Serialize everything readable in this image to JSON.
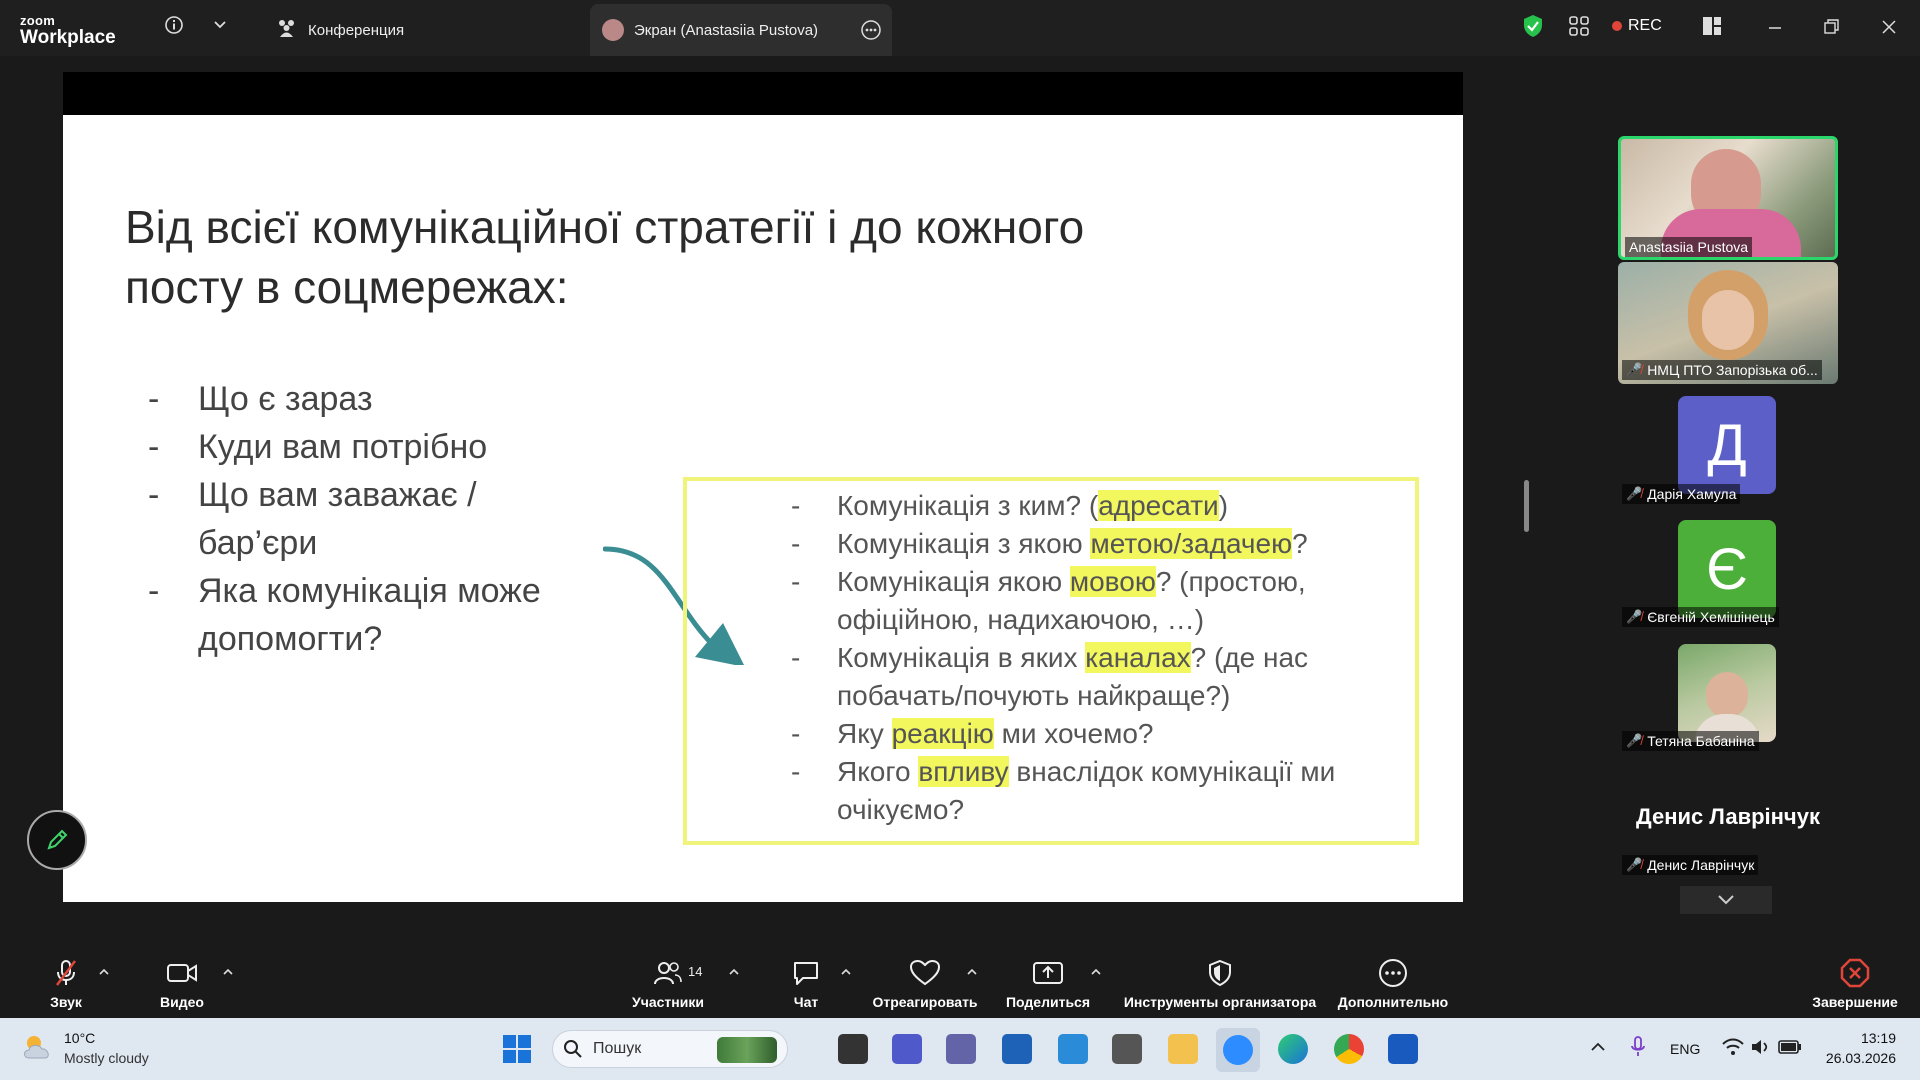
{
  "titlebar": {
    "logo_small": "zoom",
    "logo_big": "Workplace",
    "tabs": [
      {
        "label": "Конференция"
      },
      {
        "label": "Экран (Anastasiia Pustova)"
      }
    ],
    "rec_label": "REC"
  },
  "slide": {
    "title_line1": "Від всієї комунікаційної стратегії і до кожного",
    "title_line2": "посту в соцмережах:",
    "left_items": [
      "Що є зараз",
      "Куди вам потрібно",
      "Що вам заважає / бар’єри",
      "Яка комунікація може допомогти?"
    ],
    "right_items": [
      {
        "pre": "Комунікація з ким? (",
        "hl": "адресати",
        "post": ")"
      },
      {
        "pre": "Комунікація з якою ",
        "hl": "метою/задачею",
        "post": "?"
      },
      {
        "pre": "Комунікація якою ",
        "hl": "мовою",
        "post": "? (простою, офіційною, надихаючою, …)"
      },
      {
        "pre": "Комунікація в яких ",
        "hl": "каналах",
        "post": "? (де нас побачать/почують найкраще?)"
      },
      {
        "pre": "Яку ",
        "hl": "реакцію",
        "post": " ми хочемо?"
      },
      {
        "pre": "Якого ",
        "hl": "впливу",
        "post": " внаслідок комунікації ми очікуємо?"
      }
    ]
  },
  "participants": [
    {
      "name": "Anastasiia Pustova",
      "type": "video"
    },
    {
      "name": "НМЦ ПТО Запорізька об...",
      "type": "video"
    },
    {
      "name": "Дарія Хамула",
      "type": "avatar",
      "initial": "Д",
      "color": "#5b5fc7"
    },
    {
      "name": "Євгеній Хемішінець",
      "type": "avatar",
      "initial": "Є",
      "color": "#4caf3a"
    },
    {
      "name": "Тетяна Бабаніна",
      "type": "photo"
    },
    {
      "name": "Денис Лаврінчук",
      "type": "name-only",
      "big_name": "Денис Лаврінчук"
    }
  ],
  "toolbar": {
    "audio": "Звук",
    "video": "Видео",
    "participants": "Участники",
    "participants_count": "14",
    "chat": "Чат",
    "react": "Отреагировать",
    "share": "Поделиться",
    "host_tools": "Инструменты организатора",
    "more": "Дополнительно",
    "end": "Завершение"
  },
  "taskbar": {
    "weather_temp": "10°C",
    "weather_desc": "Mostly cloudy",
    "search_placeholder": "Пошук",
    "lang": "ENG",
    "time": "13:19",
    "date": "26.03.2026"
  }
}
